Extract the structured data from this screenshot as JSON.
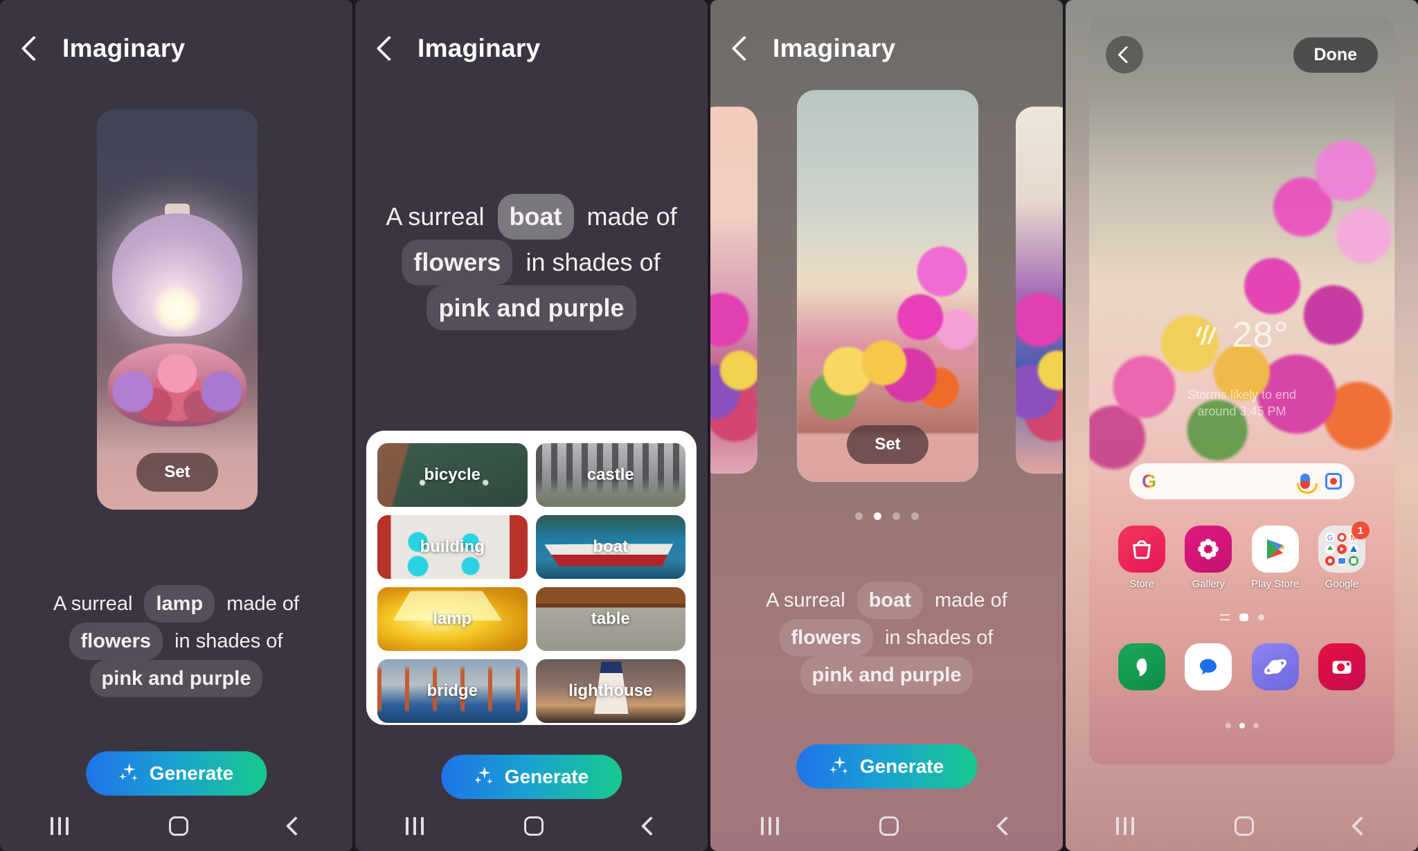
{
  "app": {
    "title": "Imaginary",
    "back_icon": "chevron-left-icon"
  },
  "panel1": {
    "title": "Imaginary",
    "set_label": "Set",
    "generate_label": "Generate",
    "sparkle_icon": "sparkle-icon",
    "prompt": {
      "t1": "A surreal",
      "subject": "lamp",
      "t2": "made of",
      "material": "flowers",
      "t3": "in shades of",
      "colors": "pink and purple"
    }
  },
  "panel2": {
    "title": "Imaginary",
    "generate_label": "Generate",
    "prompt": {
      "t1": "A surreal",
      "subject": "boat",
      "t2": "made of",
      "material": "flowers",
      "t3": "in shades of",
      "colors": "pink and purple"
    },
    "word_options": [
      {
        "label": "bicycle",
        "selected": false
      },
      {
        "label": "castle",
        "selected": false
      },
      {
        "label": "building",
        "selected": false
      },
      {
        "label": "boat",
        "selected": true
      },
      {
        "label": "lamp",
        "selected": false
      },
      {
        "label": "table",
        "selected": false
      },
      {
        "label": "bridge",
        "selected": false
      },
      {
        "label": "lighthouse",
        "selected": false
      }
    ]
  },
  "panel3": {
    "title": "Imaginary",
    "set_label": "Set",
    "generate_label": "Generate",
    "carousel_dots": 4,
    "carousel_active_index": 1,
    "prompt": {
      "t1": "A surreal",
      "subject": "boat",
      "t2": "made of",
      "material": "flowers",
      "t3": "in shades of",
      "colors": "pink and purple"
    }
  },
  "panel4": {
    "back_icon": "chevron-left-icon",
    "done_label": "Done",
    "weather": {
      "icon": "rain-icon",
      "temperature": "28°",
      "description_line1": "Storms likely to end",
      "description_line2": "around 3:45 PM"
    },
    "search_widget": {
      "logo": "google-g-icon",
      "mic_icon": "microphone-icon",
      "lens_icon": "google-lens-icon"
    },
    "apps": [
      {
        "label": "Store",
        "icon": "shopping-bag-icon",
        "badge": ""
      },
      {
        "label": "Gallery",
        "icon": "flower-icon",
        "badge": ""
      },
      {
        "label": "Play Store",
        "icon": "play-store-icon",
        "badge": ""
      },
      {
        "label": "Google",
        "icon": "google-folder-icon",
        "badge": "1"
      }
    ],
    "dock": [
      {
        "label": "Phone",
        "icon": "phone-icon"
      },
      {
        "label": "Messages",
        "icon": "message-bubble-icon"
      },
      {
        "label": "Internet",
        "icon": "browser-planet-icon"
      },
      {
        "label": "Camera",
        "icon": "camera-icon"
      }
    ],
    "home_page_indicator": [
      "apps-list-icon",
      "home-page-active",
      "page-dot"
    ],
    "wallpaper_pages": 3,
    "wallpaper_active_page": 1
  },
  "navbar": {
    "recents_icon": "recents-icon",
    "home_icon": "home-icon",
    "back_icon": "back-icon"
  },
  "colors": {
    "generate_gradient_start": "#1f73e8",
    "generate_gradient_end": "#17c98d",
    "selected_tile_outline": "#3b6ef0",
    "badge": "#f04e36"
  }
}
